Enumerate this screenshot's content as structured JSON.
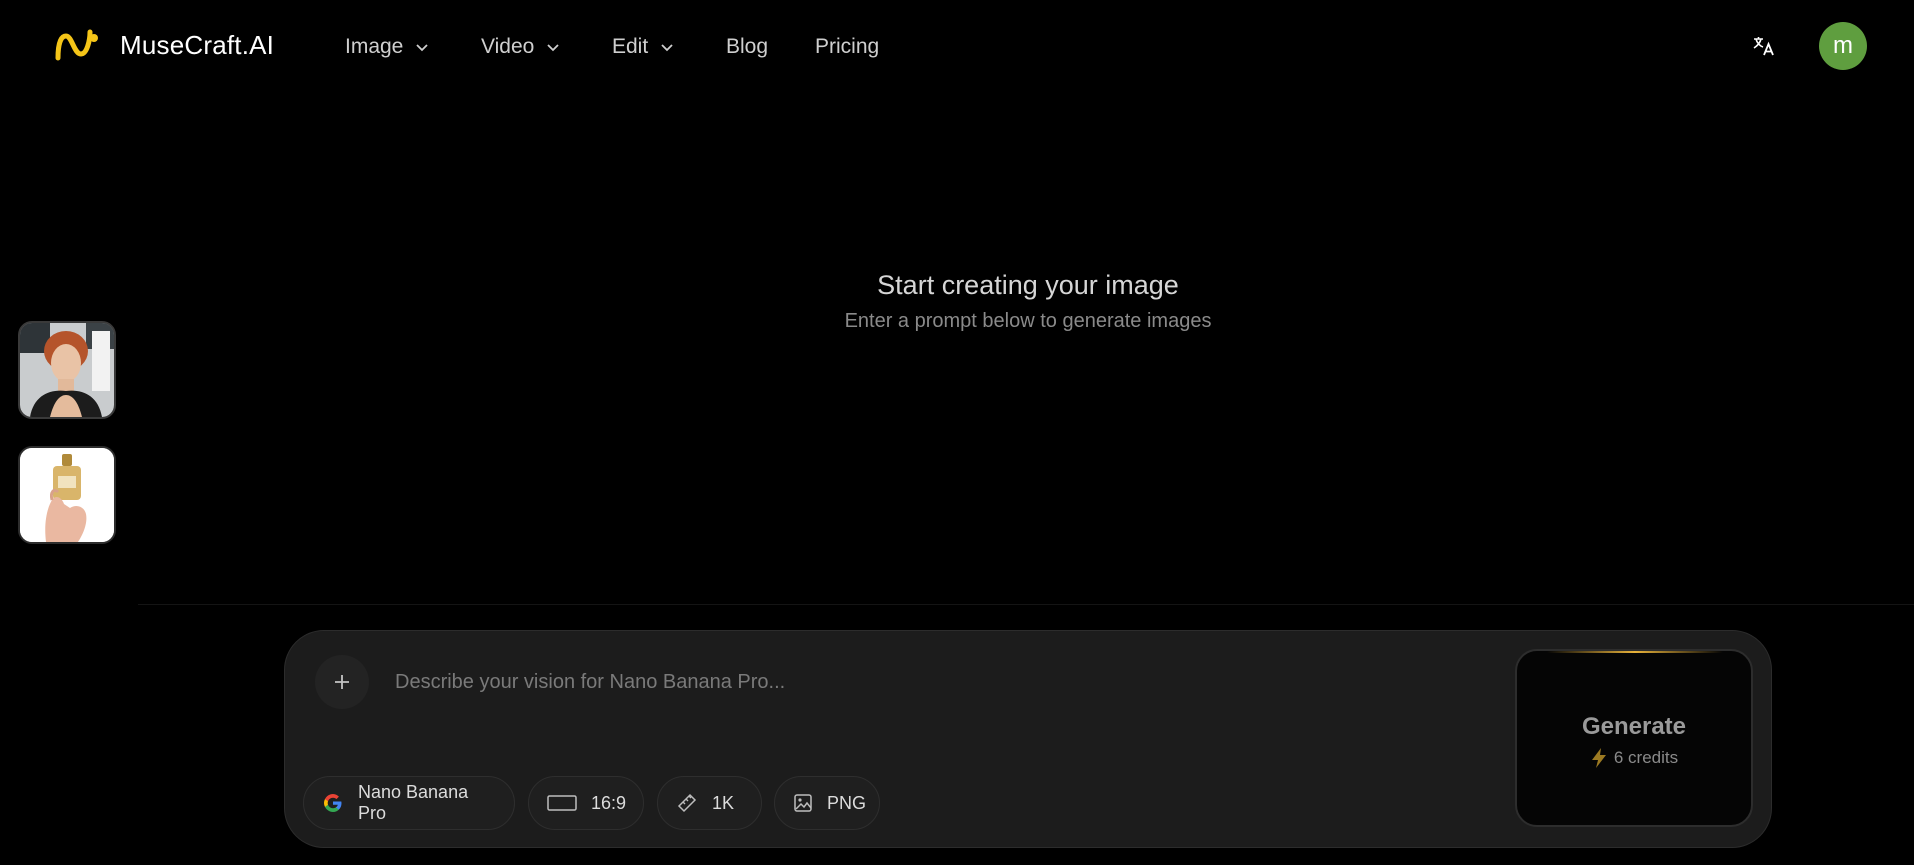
{
  "header": {
    "brand": "MuseCraft.AI",
    "nav": [
      {
        "label": "Image",
        "has_dropdown": true
      },
      {
        "label": "Video",
        "has_dropdown": true
      },
      {
        "label": "Edit",
        "has_dropdown": true
      },
      {
        "label": "Blog",
        "has_dropdown": false
      },
      {
        "label": "Pricing",
        "has_dropdown": false
      }
    ],
    "translate_icon": "translate-icon",
    "avatar_initial": "m",
    "avatar_color": "#5f9e3f"
  },
  "thumbnails": [
    {
      "icon": "portrait-image"
    },
    {
      "icon": "perfume-bottle-image"
    }
  ],
  "empty_state": {
    "title": "Start creating your image",
    "subtitle": "Enter a prompt below to generate images"
  },
  "composer": {
    "placeholder": "Describe your vision for Nano Banana Pro...",
    "value": "",
    "chips": {
      "model": "Nano Banana Pro",
      "ratio": "16:9",
      "resolution": "1K",
      "format": "PNG"
    },
    "generate": {
      "label": "Generate",
      "credits": "6 credits",
      "accent_color": "#e8b23a"
    }
  },
  "colors": {
    "background": "#000000",
    "composer_bg": "#1c1c1c",
    "accent": "#f5c518"
  }
}
